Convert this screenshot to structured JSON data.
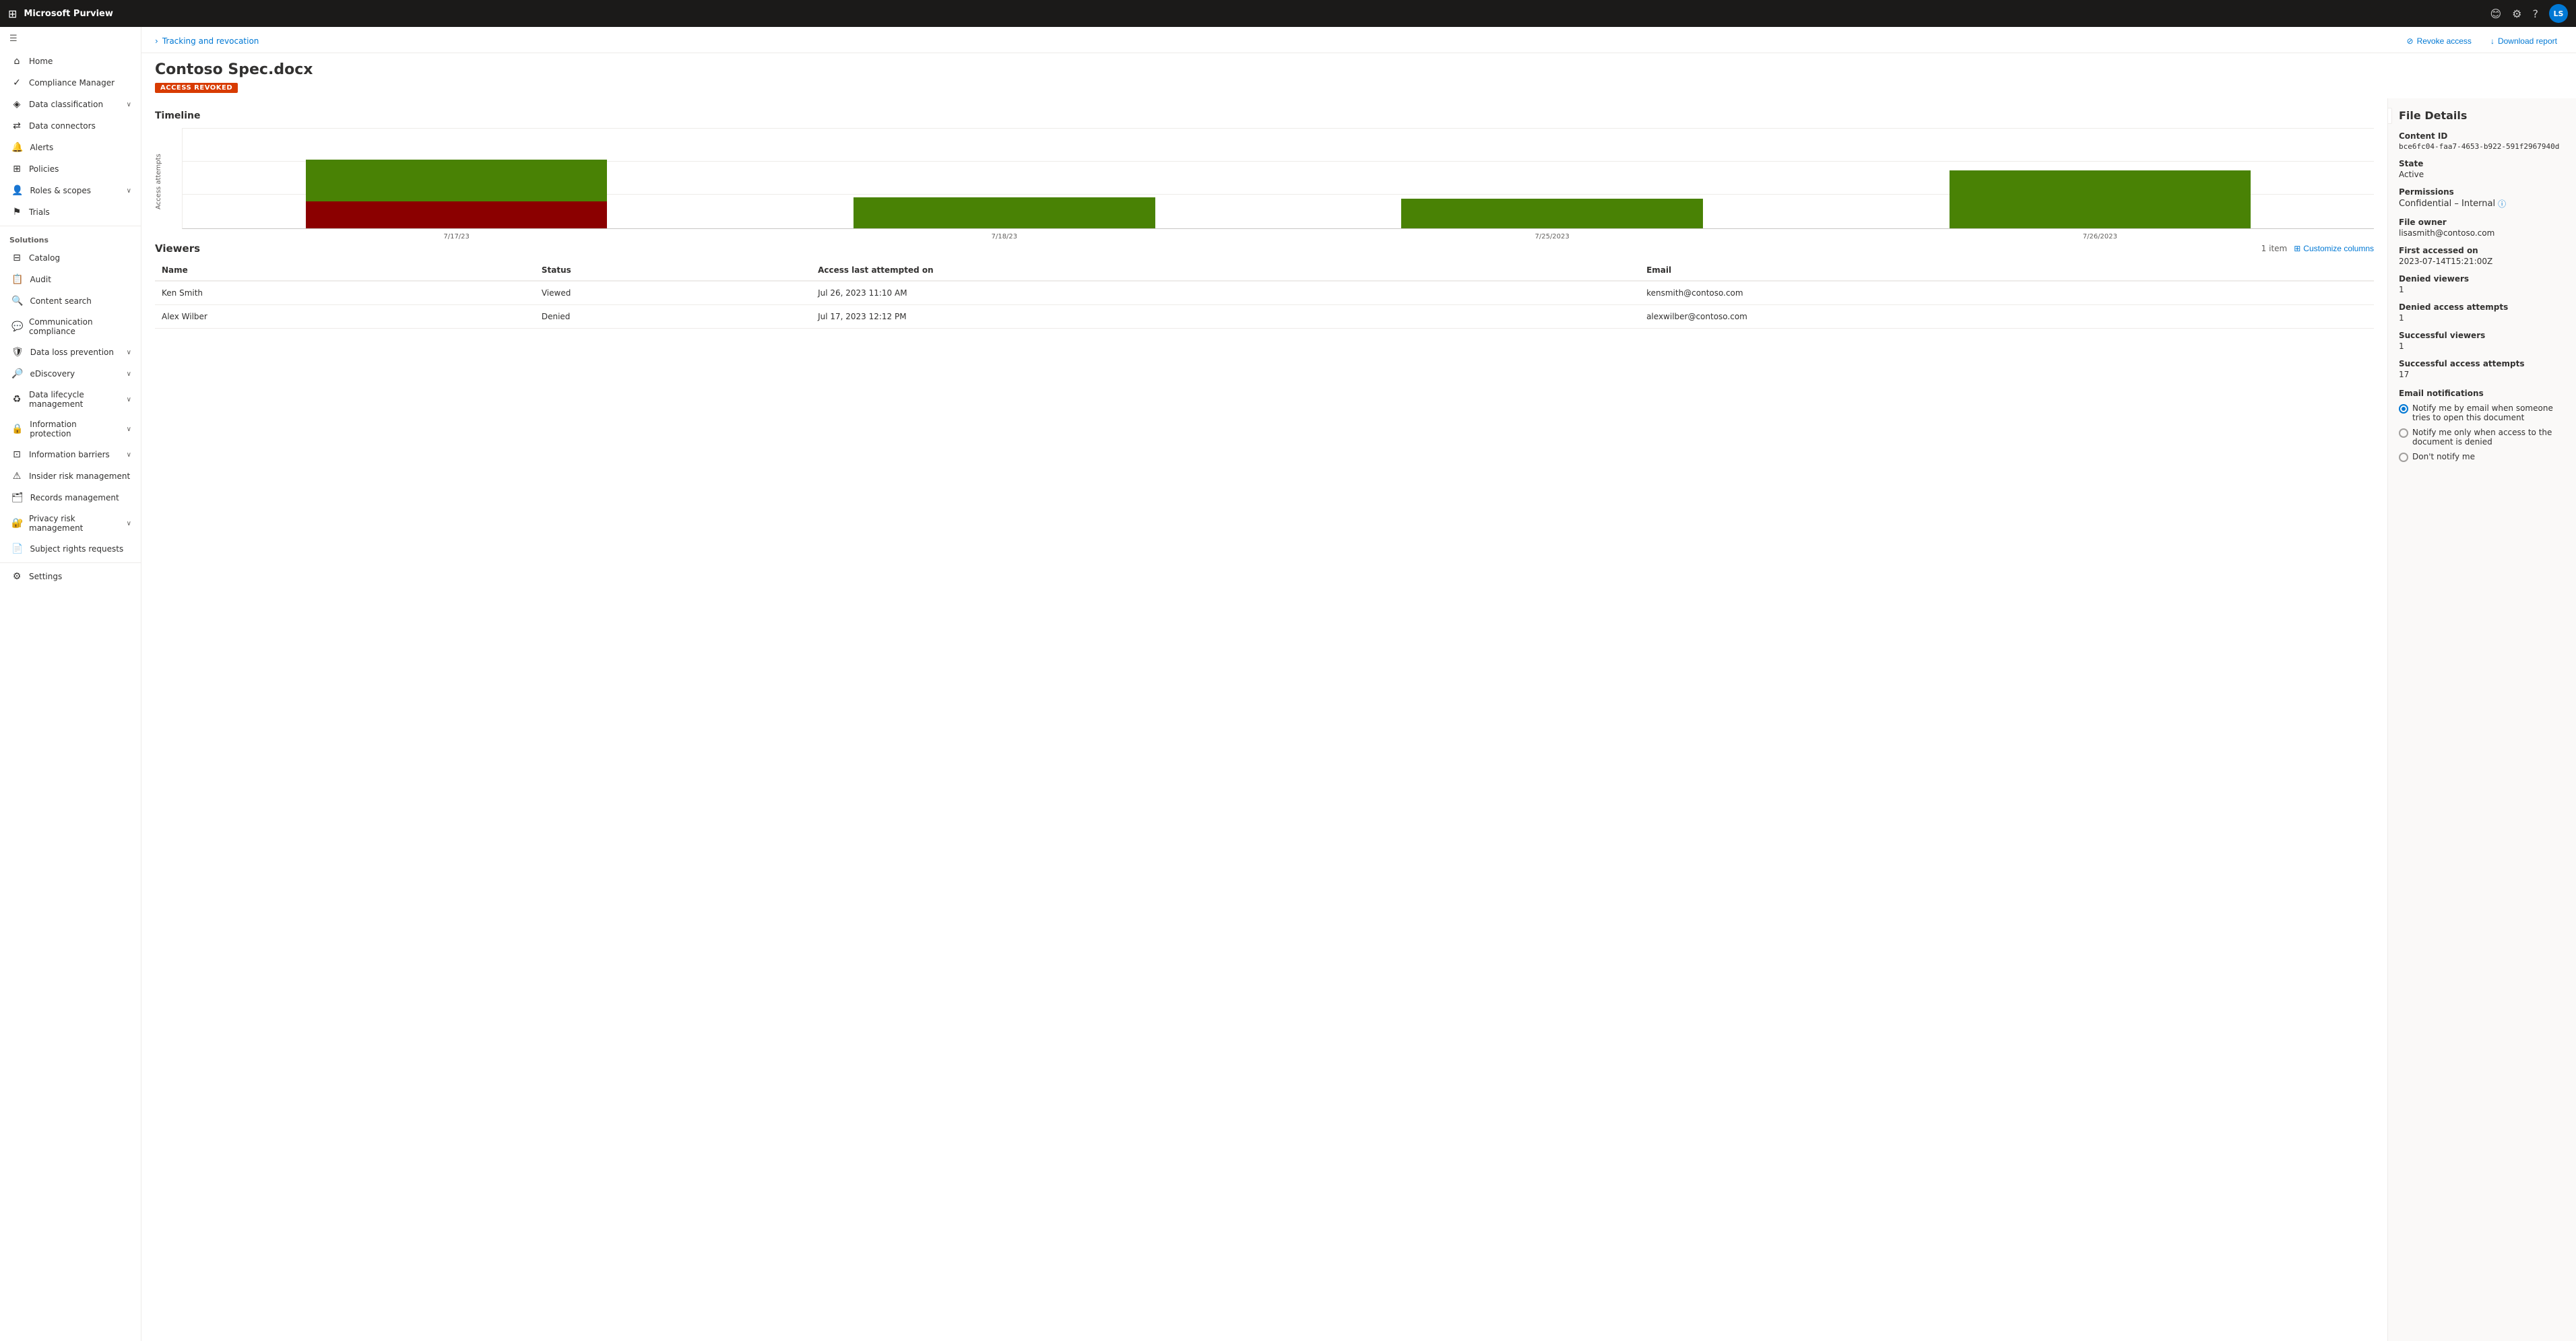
{
  "app": {
    "name": "Microsoft Purview",
    "avatar_initials": "LS"
  },
  "topbar": {
    "icons": [
      "grid",
      "feedback",
      "settings",
      "help"
    ]
  },
  "sidebar": {
    "hamburger": "☰",
    "nav_items": [
      {
        "id": "home",
        "label": "Home",
        "icon": "⌂",
        "expandable": false
      },
      {
        "id": "compliance-manager",
        "label": "Compliance Manager",
        "icon": "✓",
        "expandable": false
      },
      {
        "id": "data-classification",
        "label": "Data classification",
        "icon": "◈",
        "expandable": true
      },
      {
        "id": "data-connectors",
        "label": "Data connectors",
        "icon": "⇄",
        "expandable": false
      },
      {
        "id": "alerts",
        "label": "Alerts",
        "icon": "🔔",
        "expandable": false
      },
      {
        "id": "policies",
        "label": "Policies",
        "icon": "⊞",
        "expandable": false
      },
      {
        "id": "roles-scopes",
        "label": "Roles & scopes",
        "icon": "👤",
        "expandable": true
      },
      {
        "id": "trials",
        "label": "Trials",
        "icon": "⚑",
        "expandable": false
      }
    ],
    "solutions_label": "Solutions",
    "solutions_items": [
      {
        "id": "catalog",
        "label": "Catalog",
        "icon": "⊟",
        "expandable": false
      },
      {
        "id": "audit",
        "label": "Audit",
        "icon": "📋",
        "expandable": false
      },
      {
        "id": "content-search",
        "label": "Content search",
        "icon": "🔍",
        "expandable": false
      },
      {
        "id": "communication-compliance",
        "label": "Communication compliance",
        "icon": "💬",
        "expandable": false
      },
      {
        "id": "data-loss-prevention",
        "label": "Data loss prevention",
        "icon": "🛡",
        "expandable": true
      },
      {
        "id": "ediscovery",
        "label": "eDiscovery",
        "icon": "🔎",
        "expandable": true
      },
      {
        "id": "data-lifecycle",
        "label": "Data lifecycle management",
        "icon": "♻",
        "expandable": true
      },
      {
        "id": "information-protection",
        "label": "Information protection",
        "icon": "🔒",
        "expandable": true
      },
      {
        "id": "information-barriers",
        "label": "Information barriers",
        "icon": "⊡",
        "expandable": true
      },
      {
        "id": "insider-risk",
        "label": "Insider risk management",
        "icon": "⚠",
        "expandable": false
      },
      {
        "id": "records-management",
        "label": "Records management",
        "icon": "🗂",
        "expandable": false
      },
      {
        "id": "privacy-risk",
        "label": "Privacy risk management",
        "icon": "🔐",
        "expandable": true
      },
      {
        "id": "subject-rights",
        "label": "Subject rights requests",
        "icon": "📄",
        "expandable": false
      }
    ],
    "settings_label": "Settings",
    "settings_icon": "⚙"
  },
  "breadcrumb": {
    "parent": "Tracking and revocation",
    "separator": "›"
  },
  "actions": {
    "revoke_label": "Revoke access",
    "revoke_icon": "⊘",
    "download_label": "Download report",
    "download_icon": "↓"
  },
  "page": {
    "title": "Contoso Spec.docx",
    "status_badge": "ACCESS REVOKED",
    "timeline_label": "Timeline",
    "chart_y_label": "Access attempts",
    "chart_data": [
      {
        "date": "7/17/23",
        "green": 55,
        "red": 35
      },
      {
        "date": "7/18/23",
        "green": 40,
        "red": 0
      },
      {
        "date": "7/25/23",
        "green": 38,
        "red": 0
      },
      {
        "date": "7/26/23",
        "green": 75,
        "red": 0
      }
    ]
  },
  "viewers": {
    "title": "Viewers",
    "item_count": "1 item",
    "customize_label": "Customize columns",
    "columns": [
      "Name",
      "Status",
      "Access last attempted on",
      "Email"
    ],
    "rows": [
      {
        "name": "Ken Smith",
        "status": "Viewed",
        "access_date": "Jul 26, 2023 11:10 AM",
        "email": "kensmith@contoso.com"
      },
      {
        "name": "Alex Wilber",
        "status": "Denied",
        "access_date": "Jul 17, 2023 12:12 PM",
        "email": "alexwilber@contoso.com"
      }
    ]
  },
  "file_details": {
    "title": "File Details",
    "fields": [
      {
        "label": "Content ID",
        "value": "bce6fc04-faa7-4653-b922-591f2967940d",
        "mono": true
      },
      {
        "label": "State",
        "value": "Active"
      },
      {
        "label": "Permissions",
        "value": "Confidential – Internal",
        "has_info": true
      },
      {
        "label": "File owner",
        "value": "lisasmith@contoso.com"
      },
      {
        "label": "First accessed on",
        "value": "2023-07-14T15:21:00Z"
      },
      {
        "label": "Denied viewers",
        "value": "1"
      },
      {
        "label": "Denied access attempts",
        "value": "1"
      },
      {
        "label": "Successful viewers",
        "value": "1"
      },
      {
        "label": "Successful access attempts",
        "value": "17"
      }
    ],
    "email_notifications_label": "Email notifications",
    "notification_options": [
      {
        "id": "notify-open",
        "label": "Notify me by email when someone tries to open this document",
        "selected": true
      },
      {
        "id": "notify-denied",
        "label": "Notify me only when access to the document is denied",
        "selected": false
      },
      {
        "id": "no-notify",
        "label": "Don't notify me",
        "selected": false
      }
    ]
  }
}
